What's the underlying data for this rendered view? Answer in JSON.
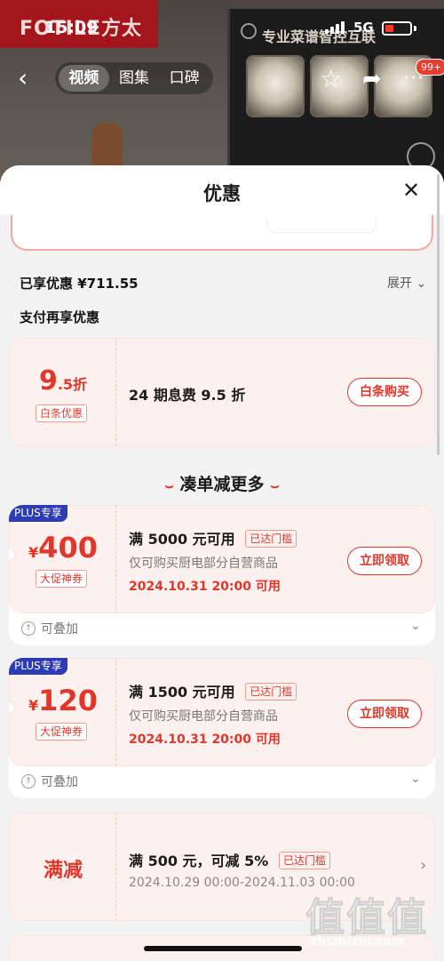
{
  "status": {
    "time": "15:09",
    "network": "5G"
  },
  "background": {
    "brand": "FOTILE方太",
    "panel_text": "专业菜谱智控互联"
  },
  "nav": {
    "tabs": [
      "视频",
      "图集",
      "口碑"
    ],
    "active_tab": "视频",
    "badge": "99+"
  },
  "sheet": {
    "title": "优惠",
    "saved_label": "已享优惠",
    "saved_amount": "¥711.55",
    "expand_label": "展开",
    "pay_section": "支付再享优惠",
    "baitiao": {
      "price_big": "9",
      "price_small": ".5折",
      "tag": "白条优惠",
      "desc": "24 期息费 9.5 折",
      "button": "白条购买"
    },
    "more_section": "凑单减更多",
    "coupons": [
      {
        "badge": "PLUS专享",
        "currency": "¥",
        "amount": "400",
        "tag": "大促神券",
        "condition": "满 5000 元可用",
        "status": "已达门槛",
        "scope": "仅可购买厨电部分自营商品",
        "time": "2024.10.31 20:00 可用",
        "button": "立即领取",
        "stack": "可叠加"
      },
      {
        "badge": "PLUS专享",
        "currency": "¥",
        "amount": "120",
        "tag": "大促神券",
        "condition": "满 1500 元可用",
        "status": "已达门槛",
        "scope": "仅可购买厨电部分自营商品",
        "time": "2024.10.31 20:00 可用",
        "button": "立即领取",
        "stack": "可叠加"
      }
    ],
    "manjian": {
      "label": "满减",
      "condition": "满 500 元，可减 5%",
      "status": "已达门槛",
      "period": "2024.10.29 00:00-2024.11.03 00:00"
    }
  },
  "watermark": {
    "glyphs": "值值值",
    "url": "zhizhizhi.com"
  }
}
